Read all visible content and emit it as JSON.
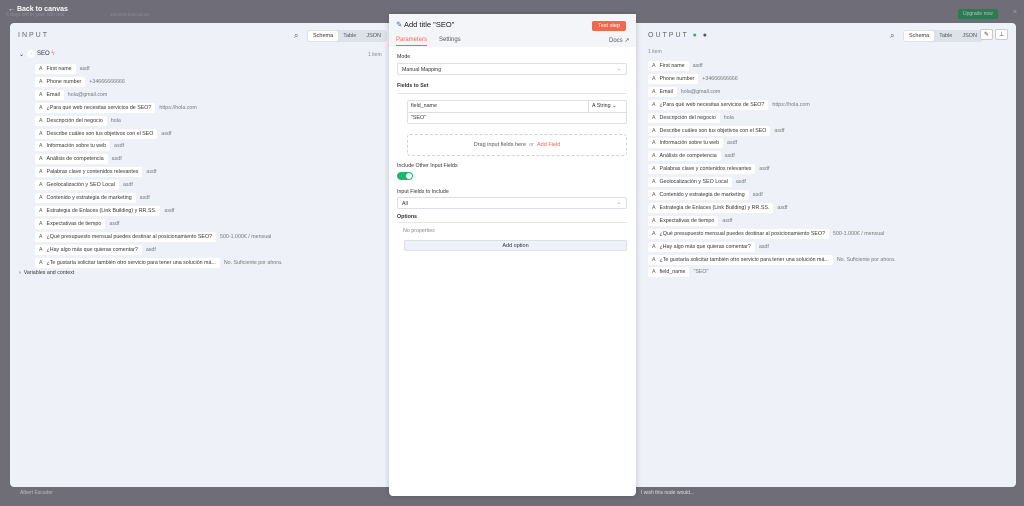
{
  "topbar": {
    "back": "← Back to canvas",
    "trial": "6 days left in your n8n trial",
    "executions": "34/1000 Executions",
    "upgrade": "Upgrade now",
    "close": "×"
  },
  "input": {
    "title": "INPUT",
    "views": [
      "Schema",
      "Table",
      "JSON"
    ],
    "active_view": "Schema",
    "node": "SEO",
    "count": "1 item",
    "variables": "Variables and context",
    "fields": [
      {
        "k": "First name",
        "v": "asdf"
      },
      {
        "k": "Phone number",
        "v": "+34666666666"
      },
      {
        "k": "Email",
        "v": "hola@gmail.com"
      },
      {
        "k": "¿Para qué web necesitas servicios de SEO?",
        "v": "https://hola.com"
      },
      {
        "k": "Descripción del negocio",
        "v": "hola"
      },
      {
        "k": "Describe cuáles son tus objetivos con el SEO",
        "v": "asdf"
      },
      {
        "k": "Información sobre tu web",
        "v": "asdf"
      },
      {
        "k": "Análisis de competencia",
        "v": "asdf"
      },
      {
        "k": "Palabras clave y contenidos relevantes",
        "v": "asdf"
      },
      {
        "k": "Geolocalización y SEO Local",
        "v": "asdf"
      },
      {
        "k": "Contenido y estrategia de marketing",
        "v": "asdf"
      },
      {
        "k": "Estrategia de Enlaces (Link Building) y RR.SS.",
        "v": "asdf"
      },
      {
        "k": "Expectativas de tiempo",
        "v": "asdf"
      },
      {
        "k": "¿Qué presupuesto mensual puedes destinar al posicionamiento SEO?",
        "v": "500-1.000€ / mensual"
      },
      {
        "k": "¿Hay algo más que quieras comentar?",
        "v": "asdf"
      },
      {
        "k": "¿Te gustaría solicitar también otro servicio para tener una solución má...",
        "v": "No. Suficiente por ahora."
      }
    ]
  },
  "node": {
    "title": "Add title \"SEO\"",
    "test": "Test step",
    "tabs": [
      "Parameters",
      "Settings"
    ],
    "docs": "Docs ↗",
    "mode_label": "Mode",
    "mode": "Manual Mapping",
    "fields_label": "Fields to Set",
    "field_name": "field_name",
    "field_type": "String",
    "field_value": "\"SEO\"",
    "drag": "Drag input fields here",
    "or": "or",
    "add_field": "Add Field",
    "include_label": "Include Other Input Fields",
    "include_on": true,
    "include_fields_label": "Input Fields to Include",
    "include_fields": "All",
    "options_label": "Options",
    "no_props": "No properties",
    "add_option": "Add option"
  },
  "output": {
    "title": "OUTPUT",
    "views": [
      "Schema",
      "Table",
      "JSON"
    ],
    "count": "1 item",
    "extra": {
      "k": "field_name",
      "v": "\"SEO\""
    }
  },
  "bottom": {
    "user": "Albert Escuder",
    "feedback": "I wish this node would..."
  }
}
